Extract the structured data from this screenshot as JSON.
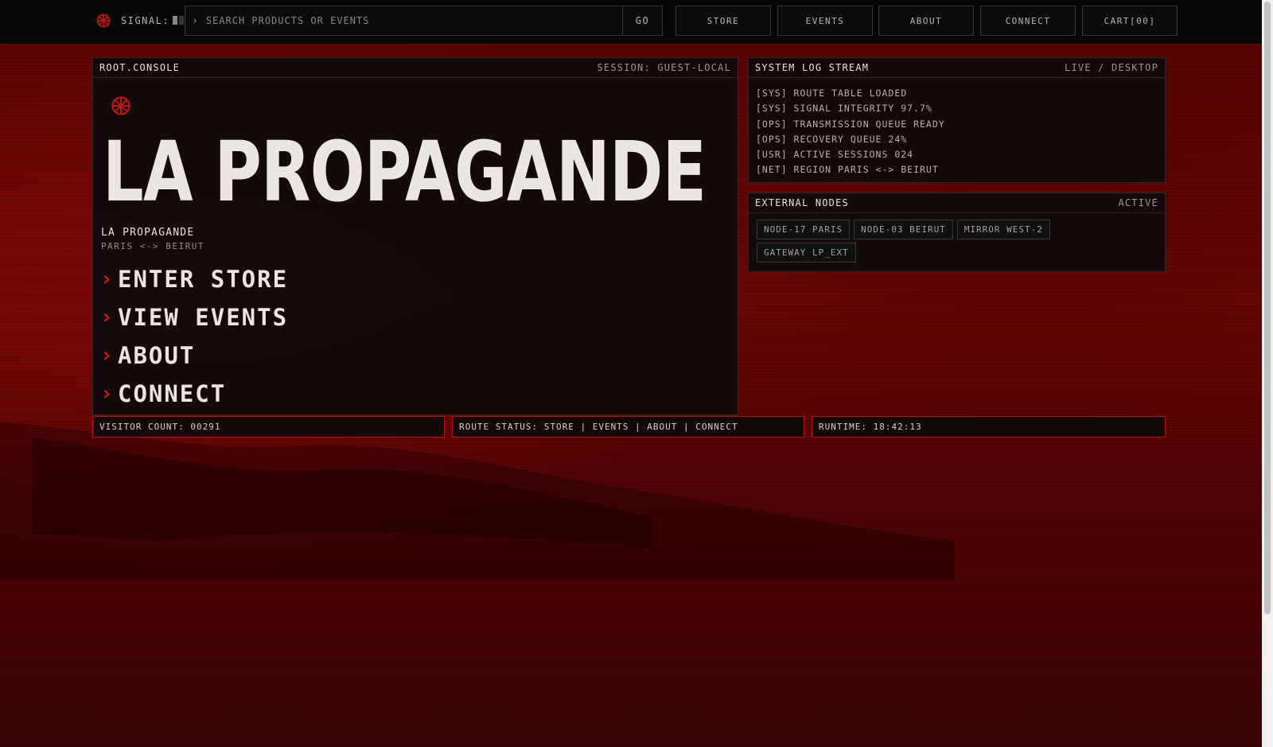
{
  "topbar": {
    "signal_label": "SIGNAL:",
    "search_placeholder": "SEARCH PRODUCTS OR EVENTS",
    "go_label": "GO",
    "nav": [
      "STORE",
      "EVENTS",
      "ABOUT",
      "CONNECT",
      "CART[00]"
    ]
  },
  "main": {
    "panel_title": "ROOT.CONSOLE",
    "panel_meta": "SESSION: GUEST-LOCAL",
    "brand_title": "LA PROPAGANDE",
    "brand_name": "LA PROPAGANDE",
    "brand_sub": "PARIS <-> BEIRUT",
    "menu": [
      {
        "chev": "›",
        "label": "ENTER STORE"
      },
      {
        "chev": "›",
        "label": "VIEW EVENTS"
      },
      {
        "chev": "›",
        "label": "ABOUT"
      },
      {
        "chev": "›",
        "label": "CONNECT"
      }
    ]
  },
  "log": {
    "title": "SYSTEM LOG STREAM",
    "meta": "LIVE / DESKTOP",
    "lines": [
      "[SYS] ROUTE TABLE LOADED",
      "[SYS] SIGNAL INTEGRITY 97.7%",
      "[OPS] TRANSMISSION QUEUE READY",
      "[OPS] RECOVERY QUEUE 24%",
      "[USR] ACTIVE SESSIONS 024",
      "[NET] REGION PARIS <-> BEIRUT"
    ]
  },
  "nodes": {
    "title": "EXTERNAL NODES",
    "meta": "ACTIVE",
    "chips": [
      "NODE-17 PARIS",
      "NODE-03 BEIRUT",
      "MIRROR WEST-2",
      "GATEWAY LP_EXT"
    ]
  },
  "status": {
    "visitors": "VISITOR COUNT: 00291",
    "route": "ROUTE STATUS: STORE | EVENTS | ABOUT | CONNECT",
    "runtime": "RUNTIME: 18:42:13"
  },
  "colors": {
    "accent": "#d21616",
    "background": "#5a0404",
    "panel": "#0e0b0b"
  },
  "icons": {
    "logo": "emblem-icon",
    "chevron": "chevron-right-icon"
  }
}
